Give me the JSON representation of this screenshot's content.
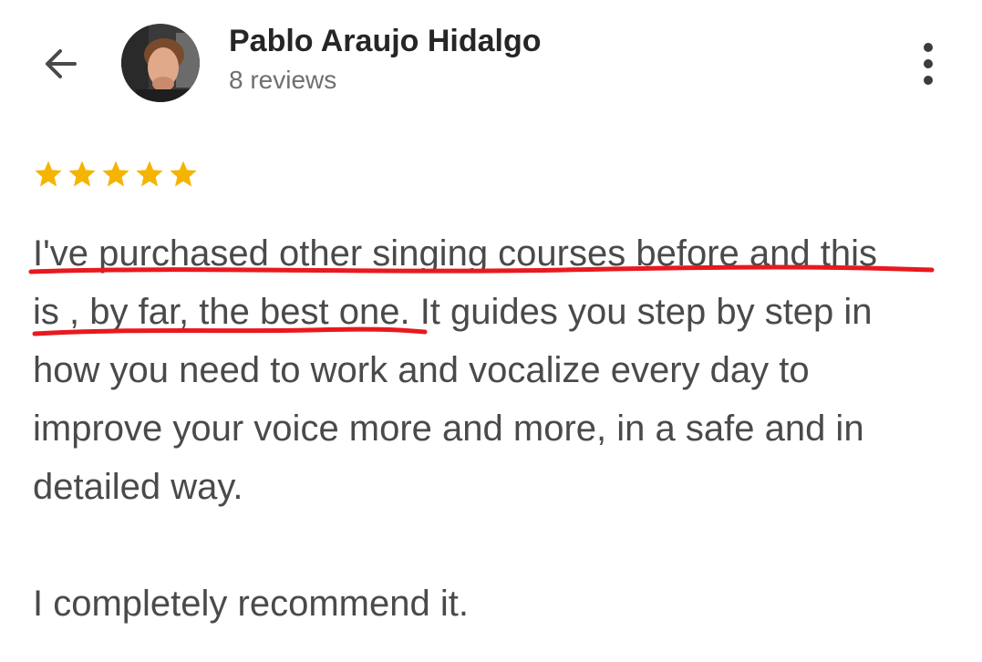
{
  "header": {
    "back_icon": "arrow-left-icon",
    "reviewer_name": "Pablo Araujo Hidalgo",
    "review_count": "8 reviews",
    "more_icon": "more-vertical-icon"
  },
  "rating": {
    "stars": 5,
    "max_stars": 5,
    "star_color": "#f5b400"
  },
  "review": {
    "lines": [
      "I've purchased other singing courses before and this",
      "is , by far, the best one. It guides you step by step in",
      "how you need to work and vocalize every day to",
      "improve your voice more and more, in a safe and in",
      "detailed way.",
      "I completely recommend it."
    ],
    "highlight_color": "#e8191e"
  }
}
